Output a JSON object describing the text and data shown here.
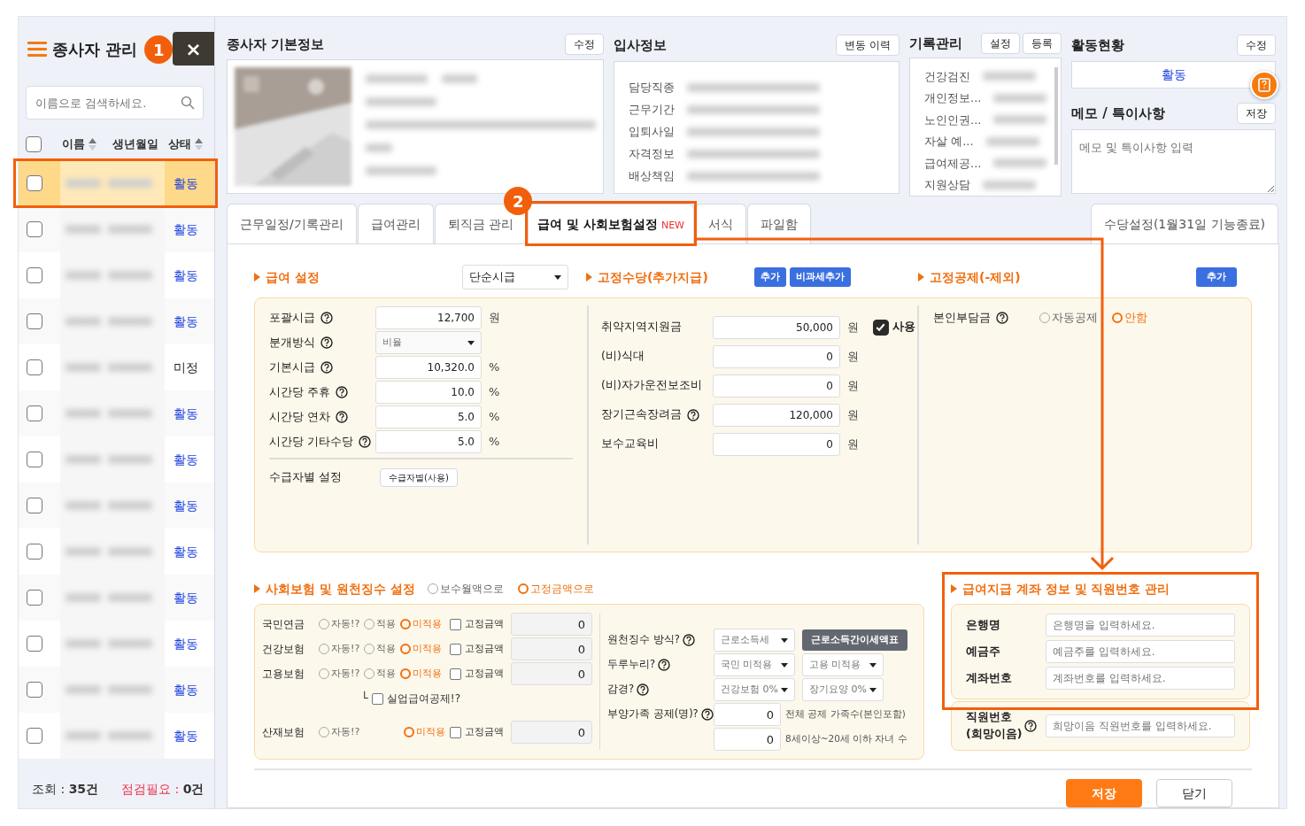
{
  "sidebar": {
    "title": "종사자 관리",
    "close_label": "×",
    "search": {
      "placeholder": "이름으로 검색하세요."
    },
    "all_checked": false,
    "columns": [
      {
        "label": "이름",
        "sortable": true
      },
      {
        "label": "생년월일",
        "sortable": false
      },
      {
        "label": "상태",
        "sortable": true
      }
    ],
    "rows": [
      {
        "selected": true,
        "checked": false,
        "status": "활동",
        "color": "#1a3fe0"
      },
      {
        "selected": false,
        "checked": false,
        "status": "활동",
        "color": "#1a3fe0"
      },
      {
        "selected": false,
        "checked": false,
        "status": "활동",
        "color": "#1a3fe0"
      },
      {
        "selected": false,
        "checked": false,
        "status": "활동",
        "color": "#1a3fe0"
      },
      {
        "selected": false,
        "checked": false,
        "status": "미정",
        "color": "#222222"
      },
      {
        "selected": false,
        "checked": false,
        "status": "활동",
        "color": "#1a3fe0"
      },
      {
        "selected": false,
        "checked": false,
        "status": "활동",
        "color": "#1a3fe0"
      },
      {
        "selected": false,
        "checked": false,
        "status": "활동",
        "color": "#1a3fe0"
      },
      {
        "selected": false,
        "checked": false,
        "status": "활동",
        "color": "#1a3fe0"
      },
      {
        "selected": false,
        "checked": false,
        "status": "활동",
        "color": "#1a3fe0"
      },
      {
        "selected": false,
        "checked": false,
        "status": "활동",
        "color": "#1a3fe0"
      },
      {
        "selected": false,
        "checked": false,
        "status": "활동",
        "color": "#1a3fe0"
      },
      {
        "selected": false,
        "checked": false,
        "status": "활동",
        "color": "#1a3fe0"
      }
    ],
    "footer": {
      "count_label": "조회 :",
      "count": "35건",
      "check_label": "점검필요 :",
      "check_count": "0건"
    }
  },
  "annotations": [
    {
      "number": "1"
    },
    {
      "number": "2"
    }
  ],
  "basic_info": {
    "title": "종사자 기본정보",
    "button": "수정"
  },
  "join_info": {
    "title": "입사정보",
    "button": "변동 이력",
    "fields": [
      "담당직종",
      "근무기간",
      "입퇴사일",
      "자격정보",
      "배상책임"
    ]
  },
  "records": {
    "title": "기록관리",
    "buttons": [
      "설정",
      "등록"
    ],
    "items": [
      "건강검진",
      "개인정보...",
      "노인인권...",
      "자살 예...",
      "급여제공...",
      "지원상담"
    ]
  },
  "activity": {
    "title": "활동현황",
    "button": "수정",
    "status": "활동"
  },
  "memo": {
    "title": "메모 / 특이사항",
    "button": "저장",
    "placeholder": "메모 및 특이사항 입력"
  },
  "tabs": [
    {
      "label": "근무일정/기록관리",
      "selected": false
    },
    {
      "label": "급여관리",
      "selected": false
    },
    {
      "label": "퇴직금 관리",
      "selected": false
    },
    {
      "label": "급여 및 사회보험설정",
      "badge": "NEW",
      "selected": true
    },
    {
      "label": "서식",
      "selected": false
    },
    {
      "label": "파일함",
      "selected": false
    }
  ],
  "side_tab": {
    "label": "수당설정(1월31일 기능종료)",
    "selected": false
  },
  "salary": {
    "title": "급여 설정",
    "type": "단순시급",
    "fields": [
      {
        "label": "포괄시급",
        "kind": "input",
        "value": "12,700",
        "unit": "원"
      },
      {
        "label": "분개방식",
        "kind": "select",
        "value": "비율"
      },
      {
        "label": "기본시급",
        "kind": "input",
        "value": "10,320.0",
        "unit": "%"
      },
      {
        "label": "시간당 주휴",
        "kind": "input",
        "value": "10.0",
        "unit": "%"
      },
      {
        "label": "시간당 연차",
        "kind": "input",
        "value": "5.0",
        "unit": "%"
      },
      {
        "label": "시간당 기타수당",
        "kind": "input",
        "value": "5.0",
        "unit": "%"
      }
    ],
    "recipient_label": "수급자별 설정",
    "recipient_button": "수급자별(사용)"
  },
  "allowance": {
    "title": "고정수당(추가지급)",
    "buttons": [
      "추가",
      "비과세추가"
    ],
    "rows": [
      {
        "label": "취약지역지원금",
        "value": "50,000",
        "unit": "원",
        "use": {
          "label": "사용",
          "checked": true
        }
      },
      {
        "label": "(비)식대",
        "value": "0",
        "unit": "원"
      },
      {
        "label": "(비)자가운전보조비",
        "value": "0",
        "unit": "원"
      },
      {
        "label": "장기근속장려금",
        "help": true,
        "value": "120,000",
        "unit": "원"
      },
      {
        "label": "보수교육비",
        "value": "0",
        "unit": "원"
      }
    ]
  },
  "deduction": {
    "title": "고정공제(-제외)",
    "button": "추가",
    "label": "본인부담금",
    "options": [
      {
        "label": "자동공제",
        "selected": false
      },
      {
        "label": "안함",
        "selected": true
      }
    ]
  },
  "insurance": {
    "title": "사회보험 및 원천징수 설정",
    "modes": [
      {
        "label": "보수월액으로",
        "selected": false
      },
      {
        "label": "고정금액으로",
        "selected": true
      }
    ],
    "rows": [
      {
        "label": "국민연금",
        "options": [
          {
            "label": "자동!?",
            "selected": false
          },
          {
            "label": "적용",
            "selected": false
          },
          {
            "label": "미적용",
            "selected": true
          }
        ],
        "fixed": {
          "label": "고정금액",
          "checked": false
        },
        "value": "0"
      },
      {
        "label": "건강보험",
        "options": [
          {
            "label": "자동!?",
            "selected": false
          },
          {
            "label": "적용",
            "selected": false
          },
          {
            "label": "미적용",
            "selected": true
          }
        ],
        "fixed": {
          "label": "고정금액",
          "checked": false
        },
        "value": "0"
      },
      {
        "label": "고용보험",
        "options": [
          {
            "label": "자동!?",
            "selected": false
          },
          {
            "label": "적용",
            "selected": false
          },
          {
            "label": "미적용",
            "selected": true
          }
        ],
        "fixed": {
          "label": "고정금액",
          "checked": false
        },
        "value": "0",
        "sub": {
          "mark": "└",
          "label": "실업급여공제!?",
          "checked": false
        }
      },
      {
        "label": "산재보험",
        "options": [
          {
            "label": "자동!?",
            "selected": false
          },
          {
            "label": "미적용",
            "selected": true
          }
        ],
        "fixed": {
          "label": "고정금액",
          "checked": false
        },
        "value": "0"
      }
    ]
  },
  "withholding": [
    {
      "label": "원천징수 방식?",
      "kind": "select_button",
      "select": "근로소득세",
      "button": "근로소득간이세액표"
    },
    {
      "label": "두루누리?",
      "kind": "two_selects",
      "selects": [
        "국민 미적용",
        "고용 미적용"
      ]
    },
    {
      "label": "감경?",
      "kind": "two_selects",
      "selects": [
        "건강보험 0%",
        "장기요양 0%"
      ]
    },
    {
      "label": "부양가족 공제(명)?",
      "kind": "input_note",
      "value": "0",
      "note": "전체 공제 가족수(본인포함)"
    },
    {
      "kind": "input_note",
      "value": "0",
      "note": "8세이상~20세 이하 자녀 수"
    }
  ],
  "bank": {
    "title": "급여지급 계좌 정보 및 직원번호 관리",
    "fields": [
      {
        "label": "은행명",
        "placeholder": "은행명을 입력하세요."
      },
      {
        "label": "예금주",
        "placeholder": "예금주를 입력하세요."
      },
      {
        "label": "계좌번호",
        "placeholder": "계좌번호를 입력하세요."
      }
    ],
    "employee": {
      "label": "직원번호",
      "label_sub": "(희망이음)",
      "placeholder": "희망이음 직원번호를 입력하세요."
    }
  },
  "actions": [
    {
      "label": "저장",
      "kind": "primary"
    },
    {
      "label": "닫기",
      "kind": "secondary"
    }
  ]
}
